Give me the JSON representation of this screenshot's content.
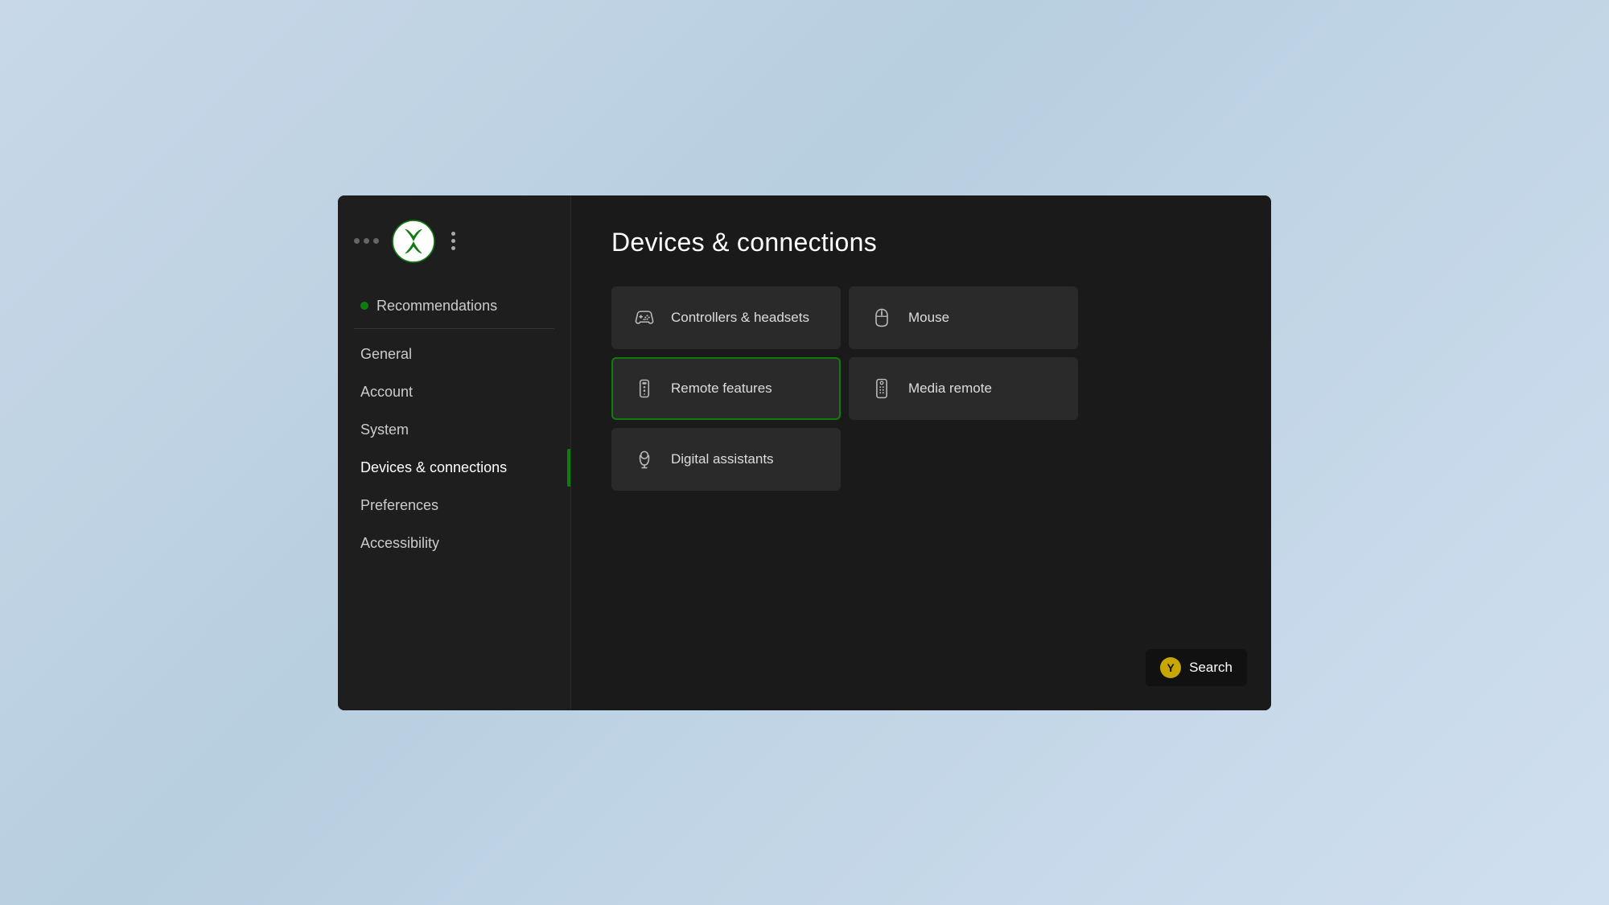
{
  "window": {
    "title": "Devices & connections"
  },
  "sidebar": {
    "nav_items": [
      {
        "id": "recommendations",
        "label": "Recommendations",
        "type": "recommendations",
        "active": false
      },
      {
        "id": "general",
        "label": "General",
        "type": "normal",
        "active": false
      },
      {
        "id": "account",
        "label": "Account",
        "type": "normal",
        "active": false
      },
      {
        "id": "system",
        "label": "System",
        "type": "normal",
        "active": false
      },
      {
        "id": "devices",
        "label": "Devices & connections",
        "type": "normal",
        "active": true
      },
      {
        "id": "preferences",
        "label": "Preferences",
        "type": "normal",
        "active": false
      },
      {
        "id": "accessibility",
        "label": "Accessibility",
        "type": "normal",
        "active": false
      }
    ]
  },
  "main": {
    "title": "Devices & connections",
    "grid_items": [
      {
        "id": "controllers-headsets",
        "label": "Controllers & headsets",
        "icon": "controller-icon",
        "selected": false,
        "full_width": false
      },
      {
        "id": "mouse",
        "label": "Mouse",
        "icon": "mouse-icon",
        "selected": false,
        "full_width": false
      },
      {
        "id": "remote-features",
        "label": "Remote features",
        "icon": "remote-icon",
        "selected": true,
        "full_width": false
      },
      {
        "id": "media-remote",
        "label": "Media remote",
        "icon": "media-remote-icon",
        "selected": false,
        "full_width": false
      },
      {
        "id": "digital-assistants",
        "label": "Digital assistants",
        "icon": "assistant-icon",
        "selected": false,
        "full_width": true
      }
    ]
  },
  "search_button": {
    "label": "Search",
    "y_button": "Y"
  },
  "colors": {
    "accent_green": "#107c10",
    "y_button_yellow": "#c8a800"
  }
}
